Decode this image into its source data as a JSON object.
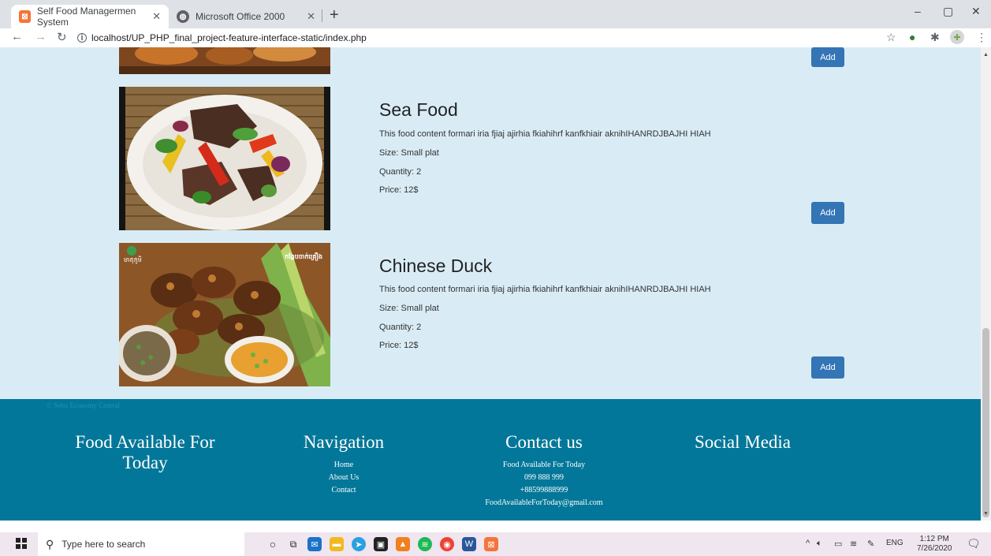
{
  "browser": {
    "tabs": [
      {
        "title": "Self Food Managermen System",
        "active": true
      },
      {
        "title": "Microsoft Office 2000",
        "active": false
      }
    ],
    "url": "localhost/UP_PHP_final_project-feature-interface-static/index.php"
  },
  "foods": [
    {
      "name": "Sea Food",
      "description": "This food content formari iria fjiaj ajirhia fkiahihrf kanfkhiair aknihIHANRDJBAJHI HIAH",
      "size": "Size: Small plat",
      "quantity": "Quantity: 2",
      "price": "Price: 12$",
      "add_label": "Add"
    },
    {
      "name": "Chinese Duck",
      "description": "This food content formari iria fjiaj ajirhia fkiahihrf kanfkhiair aknihIHANRDJBAJHI HIAH",
      "size": "Size: Small plat",
      "quantity": "Quantity: 2",
      "price": "Price: 12$",
      "add_label": "Add",
      "image_text_left": "មាតុភូមិ",
      "image_text_right": "កង្កែបចាក់គ្រឿង"
    }
  ],
  "top_add_label": "Add",
  "footer": {
    "copyright": "© Sebu Economy Central",
    "col1_title": "Food Available For Today",
    "col2_title": "Navigation",
    "nav_links": [
      "Home",
      "About Us",
      "Contact"
    ],
    "col3_title": "Contact us",
    "contact_lines": [
      "Food Available For Today",
      "099 888 999",
      "+88599888999",
      "FoodAvailableForToday@gmail.com"
    ],
    "col4_title": "Social Media"
  },
  "taskbar": {
    "search_placeholder": "Type here to search",
    "language": "ENG",
    "time": "1:12 PM",
    "date": "7/26/2020"
  },
  "colors": {
    "page_bg": "#d9ecf6",
    "footer_bg": "#037799",
    "button": "#3375b5"
  }
}
